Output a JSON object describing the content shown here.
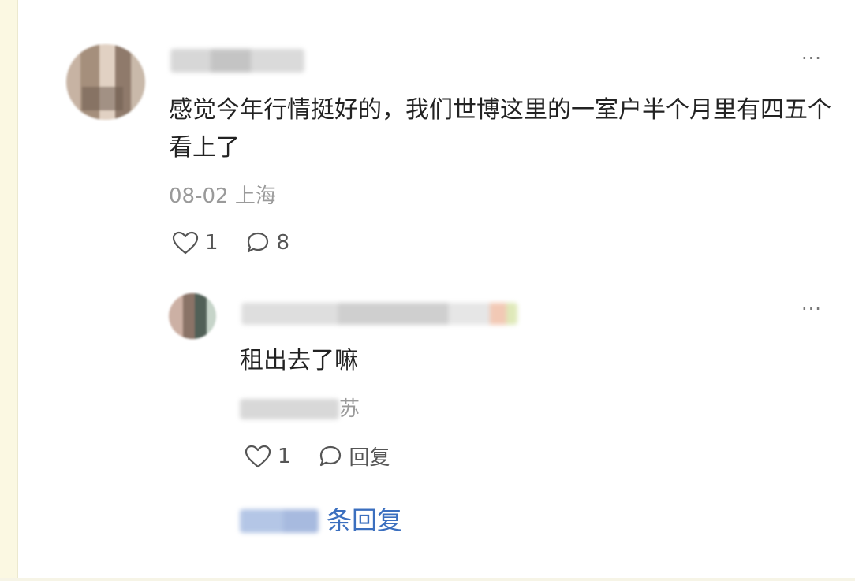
{
  "comment": {
    "text": "感觉今年行情挺好的，我们世博这里的一室户半个月里有四五个看上了",
    "date_location": "08-02 上海",
    "likes": "1",
    "replies": "8",
    "more_label": "···"
  },
  "reply": {
    "text": "租出去了嘛",
    "location_visible": "苏",
    "likes": "1",
    "reply_label": "回复",
    "more_label": "···"
  },
  "expand_label": "条回复",
  "icons": {
    "like": "heart-outline-icon",
    "comment": "comment-bubble-icon",
    "more": "more-horizontal-icon"
  }
}
